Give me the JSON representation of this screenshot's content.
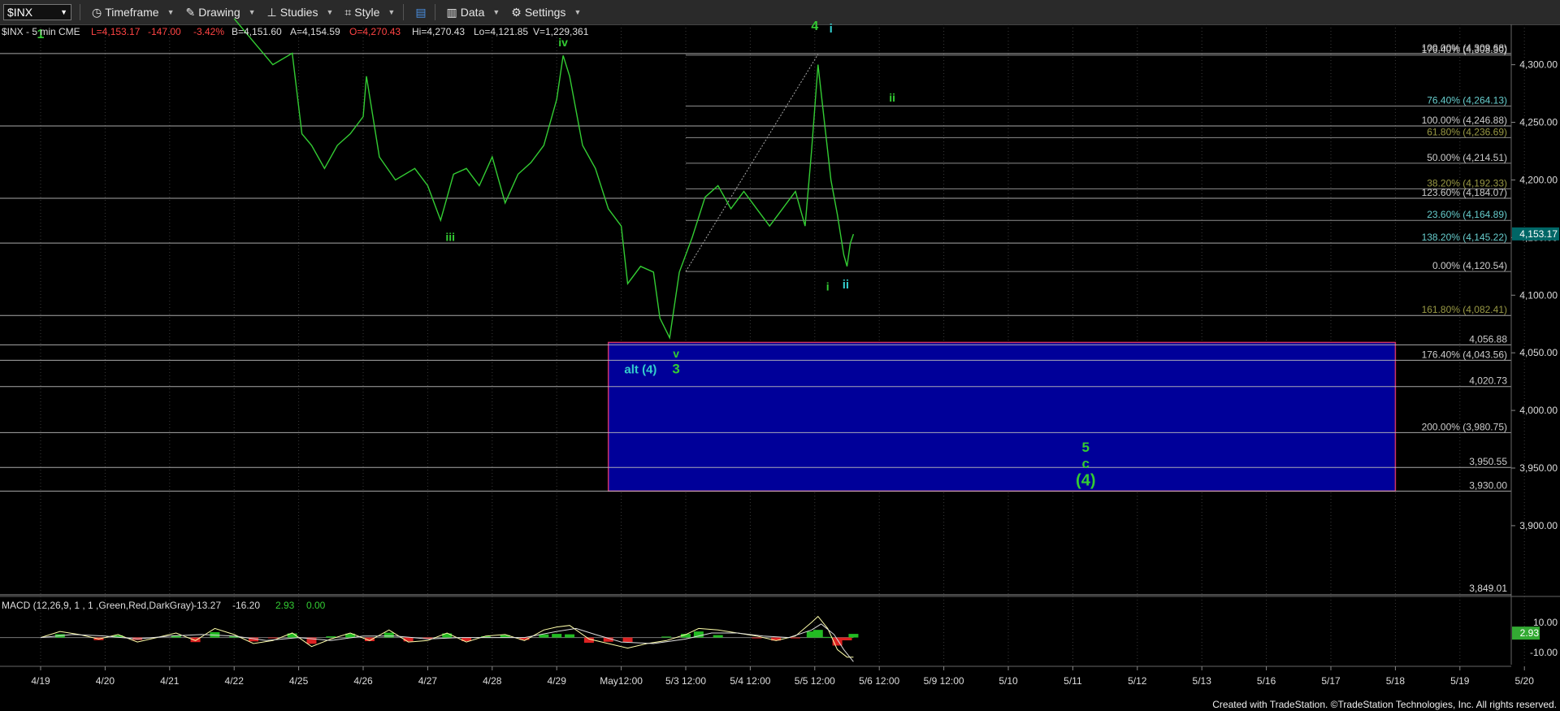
{
  "toolbar": {
    "symbol": "$INX",
    "items": [
      {
        "label": "Timeframe",
        "icon": "clock-icon"
      },
      {
        "label": "Drawing",
        "icon": "pencil-icon"
      },
      {
        "label": "Studies",
        "icon": "studies-icon"
      },
      {
        "label": "Style",
        "icon": "style-icon"
      },
      {
        "label": "",
        "icon": "layout-icon"
      },
      {
        "label": "Data",
        "icon": "data-icon"
      },
      {
        "label": "Settings",
        "icon": "gear-icon"
      }
    ]
  },
  "header": {
    "name": "$INX - 5 min  CME",
    "last": "L=4,153.17",
    "change": "-147.00",
    "pct": "-3.42%",
    "bid": "B=4,151.60",
    "ask": "A=4,154.59",
    "open": "O=4,270.43",
    "high": "Hi=4,270.43",
    "low": "Lo=4,121.85",
    "volume": "V=1,229,361"
  },
  "colors": {
    "price": "#33cc33",
    "wave_green": "#33cc33",
    "wave_cyan": "#33cccc",
    "target_box": "#000099",
    "target_border": "#cc3366",
    "fib_white": "#cccccc",
    "fib_cyan": "#66cccc",
    "fib_olive": "#999944",
    "last_price_bg": "#006666"
  },
  "chart_data": {
    "type": "line",
    "price_axis": {
      "ylim": [
        3840,
        4335
      ],
      "ticks": [
        3900,
        3950,
        4000,
        4050,
        4100,
        4150,
        4200,
        4250,
        4300
      ],
      "tick_labels": [
        "3,900.00",
        "3,950.00",
        "4,000.00",
        "4,050.00",
        "4,100.00",
        "4,150.00",
        "4,200.00",
        "4,250.00",
        "4,300.00"
      ],
      "last_price": 4153.17,
      "last_price_label": "4,153.17",
      "bottom_price_label": "3,849.01"
    },
    "x_axis": {
      "labels": [
        "4/19",
        "4/20",
        "4/21",
        "4/22",
        "4/25",
        "4/26",
        "4/27",
        "4/28",
        "4/29",
        "May12:00",
        "5/3 12:00",
        "5/4 12:00",
        "5/5 12:00",
        "5/6 12:00",
        "5/9 12:00",
        "5/10",
        "5/11",
        "5/12",
        "5/13",
        "5/16",
        "5/17",
        "5/18",
        "5/19",
        "5/20"
      ],
      "positions": [
        0,
        1,
        2,
        3,
        4,
        5,
        6,
        7,
        8,
        9,
        10,
        11,
        12,
        13,
        14,
        15,
        16,
        17,
        18,
        19,
        20,
        21,
        22,
        23
      ]
    },
    "price_series": [
      [
        3.0,
        4340
      ],
      [
        3.3,
        4320
      ],
      [
        3.6,
        4300
      ],
      [
        3.9,
        4310
      ],
      [
        4.05,
        4240
      ],
      [
        4.2,
        4230
      ],
      [
        4.4,
        4210
      ],
      [
        4.6,
        4230
      ],
      [
        4.8,
        4240
      ],
      [
        5.0,
        4255
      ],
      [
        5.05,
        4290
      ],
      [
        5.25,
        4220
      ],
      [
        5.5,
        4200
      ],
      [
        5.8,
        4210
      ],
      [
        6.0,
        4195
      ],
      [
        6.2,
        4165
      ],
      [
        6.4,
        4205
      ],
      [
        6.6,
        4210
      ],
      [
        6.8,
        4195
      ],
      [
        7.0,
        4220
      ],
      [
        7.2,
        4180
      ],
      [
        7.4,
        4205
      ],
      [
        7.6,
        4215
      ],
      [
        7.8,
        4230
      ],
      [
        8.0,
        4270
      ],
      [
        8.1,
        4308
      ],
      [
        8.2,
        4290
      ],
      [
        8.4,
        4230
      ],
      [
        8.6,
        4210
      ],
      [
        8.8,
        4175
      ],
      [
        9.0,
        4160
      ],
      [
        9.1,
        4110
      ],
      [
        9.3,
        4125
      ],
      [
        9.5,
        4120
      ],
      [
        9.6,
        4080
      ],
      [
        9.75,
        4063
      ],
      [
        9.9,
        4120
      ],
      [
        10.1,
        4150
      ],
      [
        10.3,
        4185
      ],
      [
        10.5,
        4195
      ],
      [
        10.7,
        4175
      ],
      [
        10.9,
        4190
      ],
      [
        11.1,
        4175
      ],
      [
        11.3,
        4160
      ],
      [
        11.5,
        4175
      ],
      [
        11.7,
        4190
      ],
      [
        11.85,
        4160
      ],
      [
        11.95,
        4225
      ],
      [
        12.05,
        4300
      ],
      [
        12.15,
        4250
      ],
      [
        12.25,
        4200
      ],
      [
        12.35,
        4170
      ],
      [
        12.45,
        4135
      ],
      [
        12.5,
        4125
      ],
      [
        12.55,
        4145
      ],
      [
        12.6,
        4153
      ]
    ],
    "fib_levels": [
      {
        "price": 4309.68,
        "label": "100.00% (4,309.68)",
        "color": "fib_white",
        "full": true
      },
      {
        "price": 4308.3,
        "label": "176.40% (4,308.30)",
        "color": "fib_white",
        "full": false
      },
      {
        "price": 4264.13,
        "label": "76.40% (4,264.13)",
        "color": "fib_cyan",
        "full": false
      },
      {
        "price": 4246.88,
        "label": "100.00% (4,246.88)",
        "color": "fib_white",
        "full": true
      },
      {
        "price": 4236.69,
        "label": "61.80% (4,236.69)",
        "color": "fib_olive",
        "full": false
      },
      {
        "price": 4214.51,
        "label": "50.00% (4,214.51)",
        "color": "fib_white",
        "full": false
      },
      {
        "price": 4192.33,
        "label": "38.20% (4,192.33)",
        "color": "fib_olive",
        "full": false
      },
      {
        "price": 4184.07,
        "label": "123.60% (4,184.07)",
        "color": "fib_white",
        "full": true
      },
      {
        "price": 4164.89,
        "label": "23.60% (4,164.89)",
        "color": "fib_cyan",
        "full": false
      },
      {
        "price": 4145.22,
        "label": "138.20% (4,145.22)",
        "color": "fib_cyan",
        "full": true
      },
      {
        "price": 4120.54,
        "label": "0.00% (4,120.54)",
        "color": "fib_white",
        "full": false
      },
      {
        "price": 4082.41,
        "label": "161.80% (4,082.41)",
        "color": "fib_olive",
        "full": true
      },
      {
        "price": 4056.88,
        "label": "4,056.88",
        "color": "fib_white",
        "full": true
      },
      {
        "price": 4043.56,
        "label": "176.40% (4,043.56)",
        "color": "fib_white",
        "full": true
      },
      {
        "price": 4020.73,
        "label": "4,020.73",
        "color": "fib_white",
        "full": true
      },
      {
        "price": 3980.75,
        "label": "200.00% (3,980.75)",
        "color": "fib_white",
        "full": true
      },
      {
        "price": 3950.55,
        "label": "3,950.55",
        "color": "fib_white",
        "full": true
      },
      {
        "price": 3930.0,
        "label": "3,930.00",
        "color": "fib_white",
        "full": true
      }
    ],
    "target_box": {
      "x0": 8.8,
      "x1": 21.0,
      "top": 4059.0,
      "bottom": 3930.0
    },
    "trend_line": {
      "x0": 10.0,
      "y0": 4120.54,
      "x1": 12.05,
      "y1": 4309.0
    },
    "wave_labels": [
      {
        "text": "1",
        "x": 0.0,
        "price": 4323,
        "color": "wave_green",
        "size": 16
      },
      {
        "text": "iv",
        "x": 8.1,
        "price": 4316,
        "color": "wave_green",
        "size": 14
      },
      {
        "text": "iii",
        "x": 6.35,
        "price": 4147,
        "color": "wave_green",
        "size": 14
      },
      {
        "text": "4",
        "x": 12.0,
        "price": 4330,
        "color": "wave_green",
        "size": 16
      },
      {
        "text": "i",
        "x": 12.25,
        "price": 4328,
        "color": "wave_cyan",
        "size": 15
      },
      {
        "text": "ii",
        "x": 13.2,
        "price": 4268,
        "color": "wave_green",
        "size": 14
      },
      {
        "text": "i",
        "x": 12.2,
        "price": 4104,
        "color": "wave_green",
        "size": 14
      },
      {
        "text": "ii",
        "x": 12.48,
        "price": 4106,
        "color": "wave_cyan",
        "size": 15
      },
      {
        "text": "v",
        "x": 9.85,
        "price": 4046,
        "color": "wave_green",
        "size": 14
      },
      {
        "text": "3",
        "x": 9.85,
        "price": 4032,
        "color": "wave_green",
        "size": 17
      },
      {
        "text": "alt (4)",
        "x": 9.3,
        "price": 4032,
        "color": "wave_cyan",
        "size": 15
      },
      {
        "text": "5",
        "x": 16.2,
        "price": 3964,
        "color": "wave_green",
        "size": 17
      },
      {
        "text": "c",
        "x": 16.2,
        "price": 3950,
        "color": "wave_green",
        "size": 17
      },
      {
        "text": "(4)",
        "x": 16.2,
        "price": 3935,
        "color": "wave_green",
        "size": 20
      }
    ],
    "macd": {
      "label": "MACD (12,26,9, 1 , 1 ,Green,Red,DarkGray)",
      "values": [
        "-13.27",
        "-16.20",
        "2.93",
        "0.00"
      ],
      "value_colors": [
        "#dddddd",
        "#dddddd",
        "#33cc33",
        "#33cc33"
      ],
      "ylim": [
        -18,
        24
      ],
      "ticks": [
        10,
        -10
      ],
      "tick_labels": [
        "10.00",
        "-10.00"
      ],
      "last_label": "2.93",
      "macd_line": [
        [
          0,
          0
        ],
        [
          0.3,
          4
        ],
        [
          0.6,
          2
        ],
        [
          0.9,
          -1
        ],
        [
          1.2,
          2
        ],
        [
          1.5,
          -3
        ],
        [
          1.8,
          0
        ],
        [
          2.1,
          3
        ],
        [
          2.4,
          -2
        ],
        [
          2.7,
          6
        ],
        [
          3.0,
          2
        ],
        [
          3.3,
          -4
        ],
        [
          3.6,
          -2
        ],
        [
          3.9,
          3
        ],
        [
          4.2,
          -6
        ],
        [
          4.5,
          -1
        ],
        [
          4.8,
          3
        ],
        [
          5.1,
          -2
        ],
        [
          5.4,
          5
        ],
        [
          5.7,
          -3
        ],
        [
          6.0,
          -2
        ],
        [
          6.3,
          3
        ],
        [
          6.6,
          -3
        ],
        [
          6.9,
          1
        ],
        [
          7.2,
          2
        ],
        [
          7.5,
          -2
        ],
        [
          7.8,
          5
        ],
        [
          8.0,
          7
        ],
        [
          8.2,
          8
        ],
        [
          8.5,
          -1
        ],
        [
          8.8,
          -4
        ],
        [
          9.1,
          -7
        ],
        [
          9.4,
          -4
        ],
        [
          9.7,
          -2
        ],
        [
          10.0,
          2
        ],
        [
          10.2,
          6
        ],
        [
          10.5,
          5
        ],
        [
          10.8,
          3
        ],
        [
          11.1,
          1
        ],
        [
          11.4,
          -2
        ],
        [
          11.7,
          1
        ],
        [
          11.95,
          10
        ],
        [
          12.05,
          14
        ],
        [
          12.2,
          6
        ],
        [
          12.35,
          -8
        ],
        [
          12.5,
          -13
        ],
        [
          12.6,
          -13
        ]
      ],
      "signal_line": [
        [
          0,
          0
        ],
        [
          0.5,
          2
        ],
        [
          1.0,
          1
        ],
        [
          1.5,
          -1
        ],
        [
          2.0,
          1
        ],
        [
          2.5,
          2
        ],
        [
          3.0,
          1
        ],
        [
          3.5,
          -2
        ],
        [
          4.0,
          0
        ],
        [
          4.5,
          -2
        ],
        [
          5.0,
          1
        ],
        [
          5.5,
          1
        ],
        [
          6.0,
          -1
        ],
        [
          6.5,
          0
        ],
        [
          7.0,
          0
        ],
        [
          7.5,
          0
        ],
        [
          8.0,
          4
        ],
        [
          8.3,
          6
        ],
        [
          8.6,
          2
        ],
        [
          9.0,
          -3
        ],
        [
          9.5,
          -4
        ],
        [
          10.0,
          -1
        ],
        [
          10.4,
          3
        ],
        [
          10.8,
          3
        ],
        [
          11.2,
          1
        ],
        [
          11.6,
          0
        ],
        [
          11.95,
          5
        ],
        [
          12.1,
          9
        ],
        [
          12.3,
          2
        ],
        [
          12.45,
          -8
        ],
        [
          12.6,
          -16
        ]
      ]
    }
  },
  "footer": "Created with TradeStation. ©TradeStation Technologies, Inc. All rights reserved."
}
